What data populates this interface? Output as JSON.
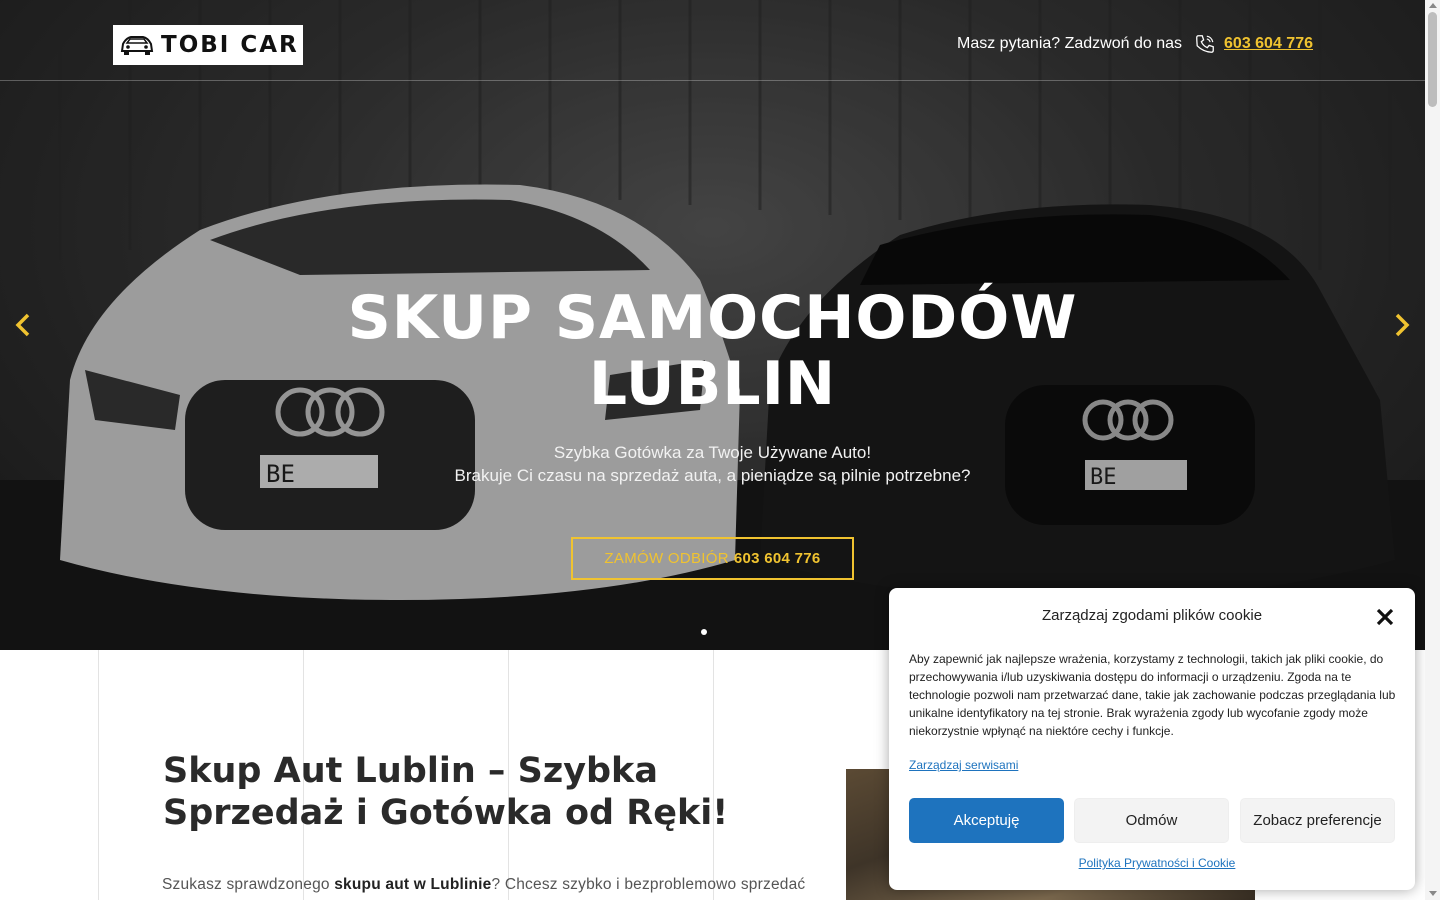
{
  "header": {
    "logo_text": "TOBI CAR",
    "contact_text": "Masz pytania? Zadzwoń do nas",
    "phone": "603 604 776"
  },
  "hero": {
    "title_line1": "SKUP SAMOCHODÓW",
    "title_line2": "LUBLIN",
    "subtitle_line1": "Szybka Gotówka za Twoje Używane Auto!",
    "subtitle_line2": "Brakuje Ci czasu na sprzedaż auta, a pieniądze są pilnie potrzebne?",
    "cta_label": "ZAMÓW ODBIÓR",
    "cta_phone": "603 604 776",
    "plate_left": "BE",
    "plate_right": "BE"
  },
  "content": {
    "heading_line1": "Skup Aut Lublin – Szybka",
    "heading_line2": "Sprzedaż i Gotówka od Ręki!",
    "para_start": "Szukasz sprawdzonego ",
    "para_bold": "skupu aut w Lublinie",
    "para_end": "? Chcesz szybko i bezproblemowo sprzedać"
  },
  "cookie": {
    "title": "Zarządzaj zgodami plików cookie",
    "body": "Aby zapewnić jak najlepsze wrażenia, korzystamy z technologii, takich jak pliki cookie, do przechowywania i/lub uzyskiwania dostępu do informacji o urządzeniu. Zgoda na te technologie pozwoli nam przetwarzać dane, takie jak zachowanie podczas przeglądania lub unikalne identyfikatory na tej stronie. Brak wyrażenia zgody lub wycofanie zgody może niekorzystnie wpłynąć na niektóre cechy i funkcje.",
    "manage_link": "Zarządzaj serwisami",
    "accept": "Akceptuję",
    "deny": "Odmów",
    "preferences": "Zobacz preferencje",
    "policy_link": "Polityka Prywatności i Cookie"
  },
  "colors": {
    "accent_yellow": "#f0c330",
    "cookie_blue": "#1e73be"
  },
  "icons": {
    "phone": "phone-icon",
    "prev": "chevron-left-icon",
    "next": "chevron-right-icon",
    "close": "close-icon",
    "logo": "car-logo-icon"
  }
}
